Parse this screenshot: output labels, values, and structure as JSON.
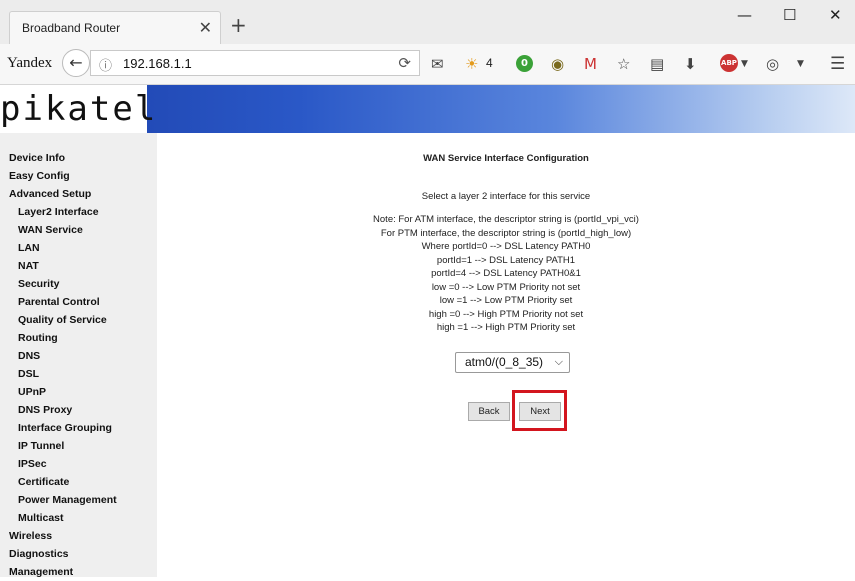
{
  "browser": {
    "tab_title": "Broadband Router",
    "tab_close": "✕",
    "new_tab": "+",
    "url": "192.168.1.1",
    "brand": "Yandex",
    "weather_value": "4",
    "badge_value": "0",
    "abp_label": "ABP",
    "window": {
      "minimize": "—",
      "maximize": "☐",
      "close": "✕"
    }
  },
  "router": {
    "logo": "pikatel",
    "menu": [
      {
        "label": "Device Info",
        "level": 1
      },
      {
        "label": "Easy Config",
        "level": 1
      },
      {
        "label": "Advanced Setup",
        "level": 1
      },
      {
        "label": "Layer2 Interface",
        "level": 2
      },
      {
        "label": "WAN Service",
        "level": 2
      },
      {
        "label": "LAN",
        "level": 2
      },
      {
        "label": "NAT",
        "level": 2
      },
      {
        "label": "Security",
        "level": 2
      },
      {
        "label": "Parental Control",
        "level": 2
      },
      {
        "label": "Quality of Service",
        "level": 2
      },
      {
        "label": "Routing",
        "level": 2
      },
      {
        "label": "DNS",
        "level": 2
      },
      {
        "label": "DSL",
        "level": 2
      },
      {
        "label": "UPnP",
        "level": 2
      },
      {
        "label": "DNS Proxy",
        "level": 2
      },
      {
        "label": "Interface Grouping",
        "level": 2
      },
      {
        "label": "IP Tunnel",
        "level": 2
      },
      {
        "label": "IPSec",
        "level": 2
      },
      {
        "label": "Certificate",
        "level": 2
      },
      {
        "label": "Power Management",
        "level": 2
      },
      {
        "label": "Multicast",
        "level": 2
      },
      {
        "label": "Wireless",
        "level": 1
      },
      {
        "label": "Diagnostics",
        "level": 1
      },
      {
        "label": "Management",
        "level": 1
      }
    ],
    "title": "WAN Service Interface Configuration",
    "subtitle": "Select a layer 2 interface for this service",
    "notes": [
      "Note: For ATM interface, the descriptor string is (portId_vpi_vci)",
      "For PTM interface, the descriptor string is (portId_high_low)",
      "Where portId=0 --> DSL Latency PATH0",
      "portId=1 --> DSL Latency PATH1",
      "portId=4 --> DSL Latency PATH0&1",
      "low =0 --> Low PTM Priority not set",
      "low =1 --> Low PTM Priority set",
      "high =0 --> High PTM Priority not set",
      "high =1 --> High PTM Priority set"
    ],
    "interface_select": "atm0/(0_8_35)",
    "back_label": "Back",
    "next_label": "Next",
    "highlight_color": "#d3151e"
  }
}
